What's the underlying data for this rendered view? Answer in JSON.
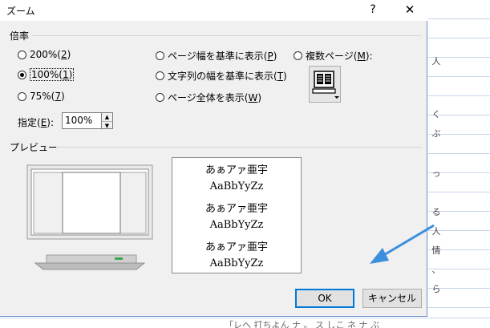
{
  "dialog": {
    "title": "ズーム",
    "help_glyph": "?",
    "close_glyph": "✕"
  },
  "zoom_group": {
    "label": "倍率",
    "options": [
      {
        "label": "200%(",
        "mnemonic": "2",
        "suffix": ")",
        "selected": false
      },
      {
        "label": "100%(",
        "mnemonic": "1",
        "suffix": ")",
        "selected": true
      },
      {
        "label": "75%(",
        "mnemonic": "7",
        "suffix": ")",
        "selected": false
      },
      {
        "label": "ページ幅を基準に表示(",
        "mnemonic": "P",
        "suffix": ")",
        "selected": false
      },
      {
        "label": "文字列の幅を基準に表示(",
        "mnemonic": "T",
        "suffix": ")",
        "selected": false
      },
      {
        "label": "ページ全体を表示(",
        "mnemonic": "W",
        "suffix": ")",
        "selected": false
      },
      {
        "label": "複数ページ(",
        "mnemonic": "M",
        "suffix": "):",
        "selected": false
      }
    ],
    "percent_label": "指定(",
    "percent_mnemonic": "E",
    "percent_suffix": "):",
    "percent_value": "100%"
  },
  "preview_group": {
    "label": "プレビュー",
    "sample_lines": [
      "あぁアァ亜宇",
      "AaBbYyZz",
      "あぁアァ亜宇",
      "AaBbYyZz",
      "あぁアァ亜宇",
      "AaBbYyZz"
    ]
  },
  "buttons": {
    "ok": "OK",
    "cancel": "キャンセル"
  },
  "background_doc": {
    "fragments": [
      "人",
      "く",
      "ぶ",
      "っ",
      "る",
      "人",
      "情",
      "、",
      "ら"
    ],
    "bottom_text": "「レヘ 打ちよん ナ 。 ス しこ ネ ナ ぶ"
  },
  "colors": {
    "dialog_bg": "#f0f0f0",
    "ok_border": "#0078d7",
    "arrow": "#3b8fdc",
    "grid_line": "#c9d5ec"
  },
  "icons": {
    "multipage": "multipage-monitor-icon",
    "arrow": "blue-arrow-annotation"
  }
}
